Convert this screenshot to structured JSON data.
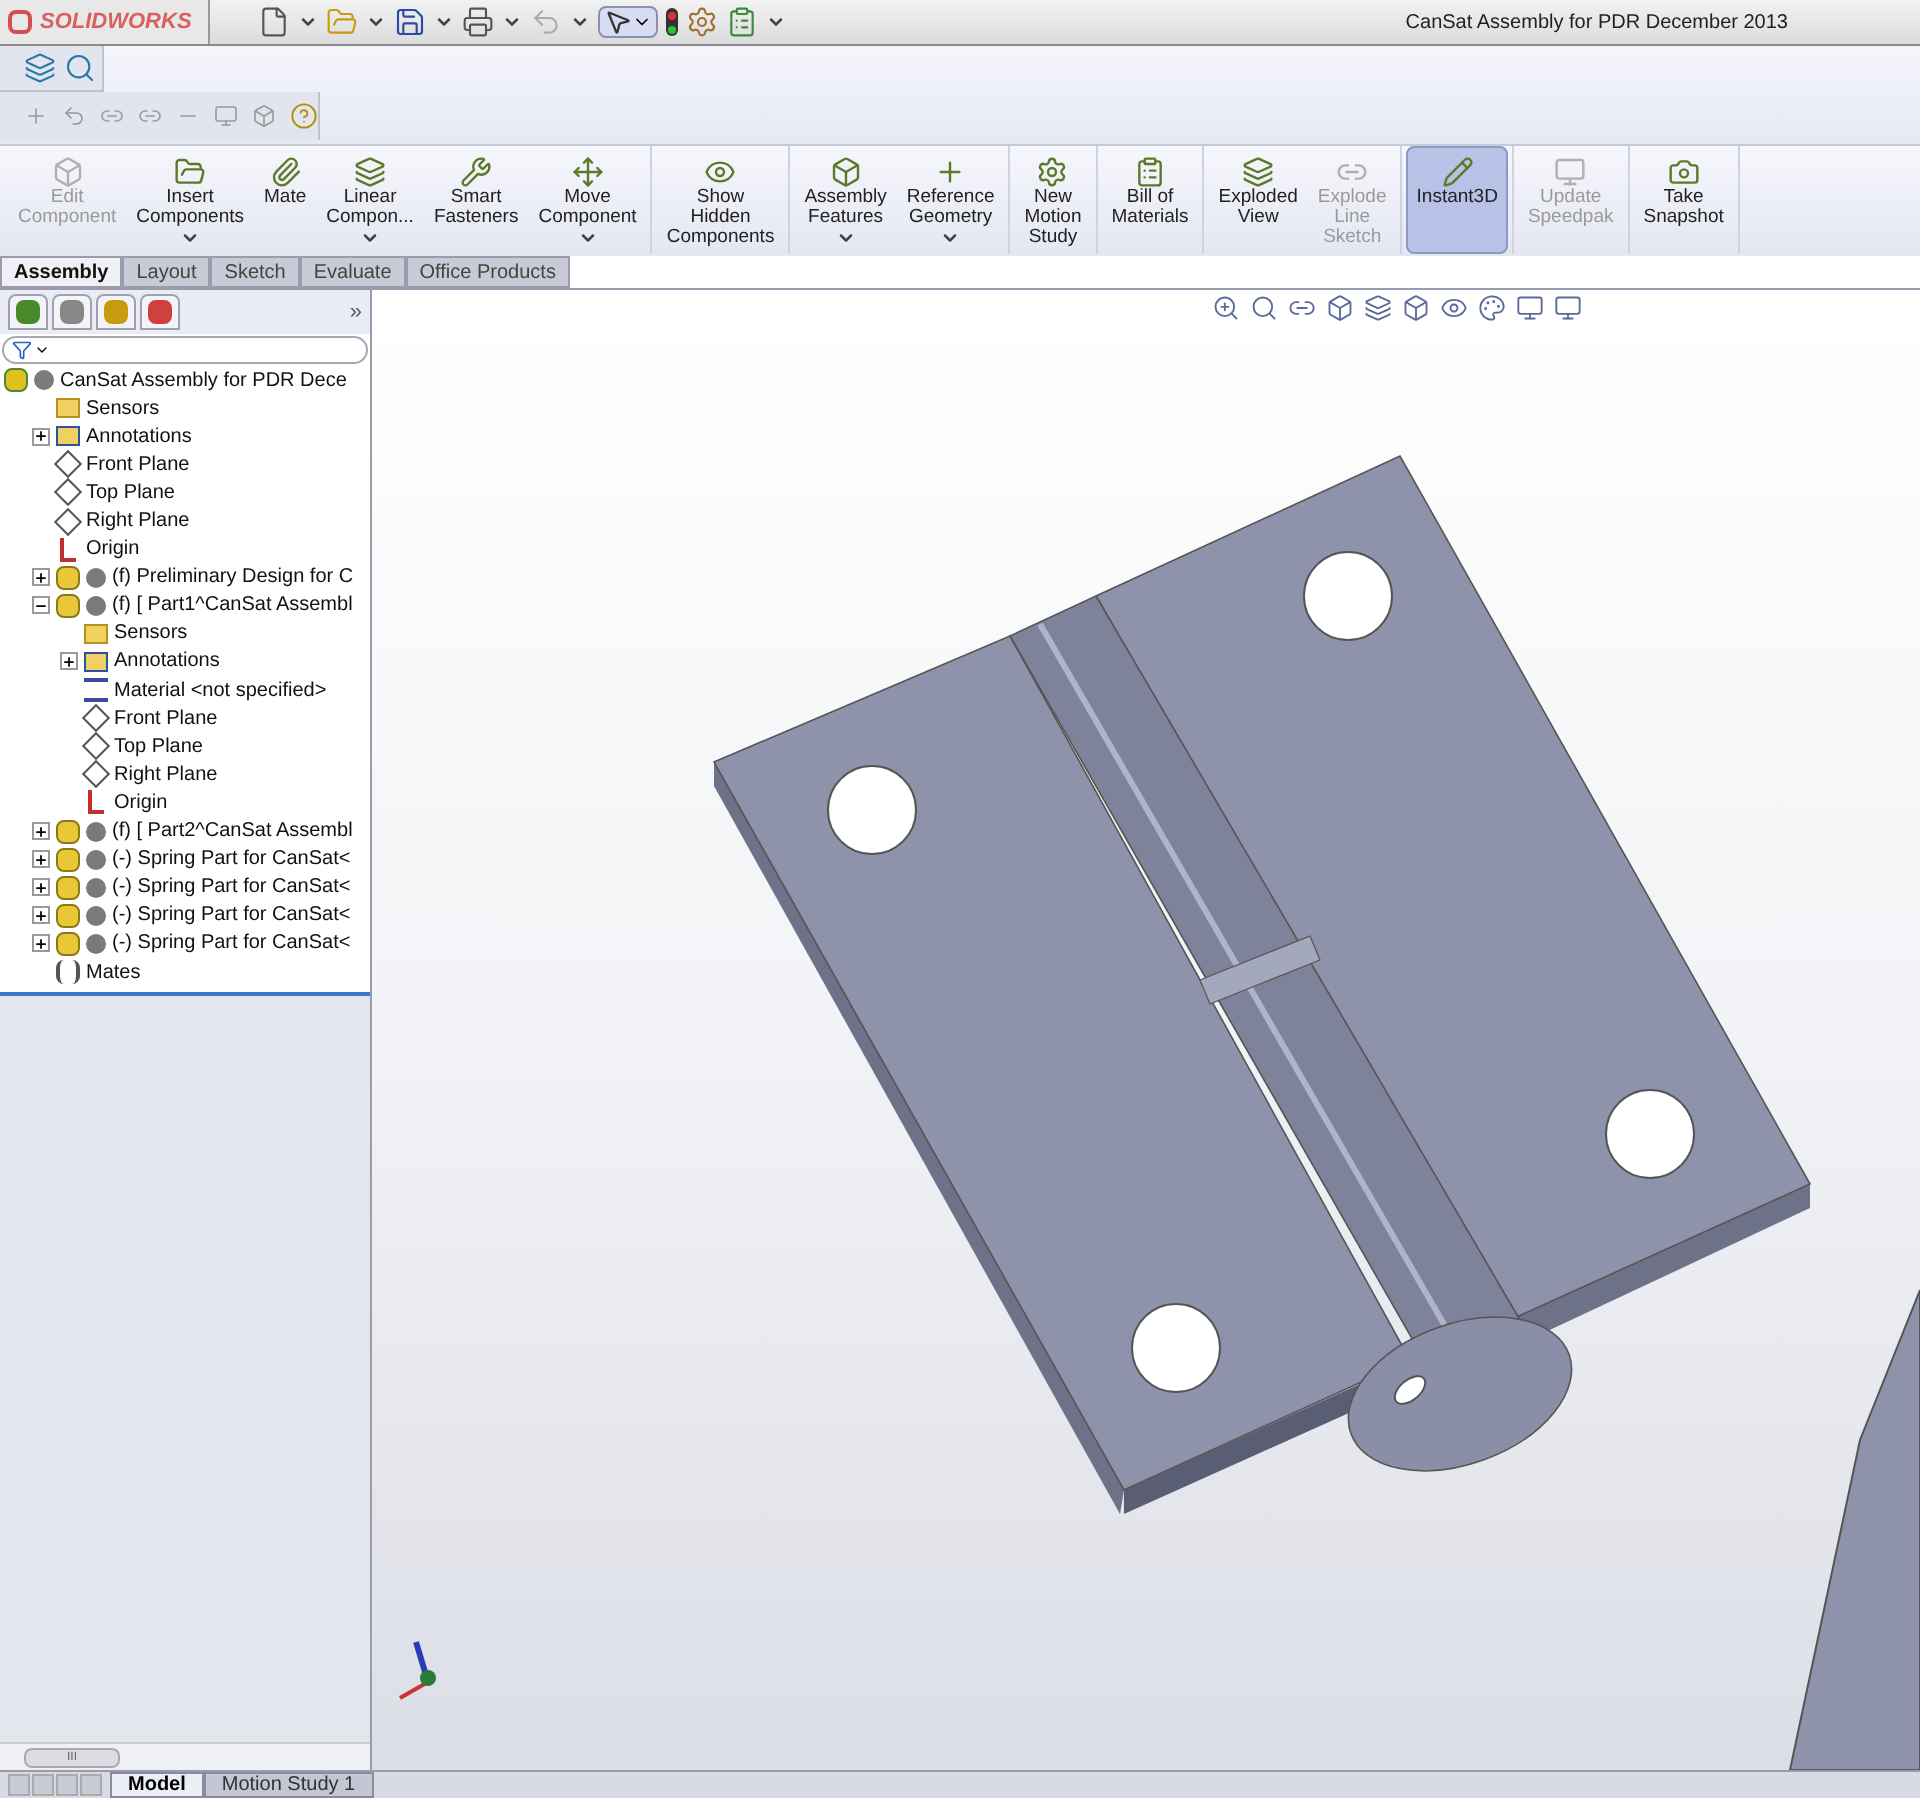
{
  "app": {
    "logo": "SOLIDWORKS",
    "title": "CanSat Assembly for PDR December 2013"
  },
  "ribbon": {
    "groups": [
      [
        {
          "label": "Edit\nComponent",
          "disabled": true,
          "selected": false,
          "dropdown": false
        },
        {
          "label": "Insert\nComponents",
          "disabled": false,
          "selected": false,
          "dropdown": true
        },
        {
          "label": "Mate",
          "disabled": false,
          "selected": false,
          "dropdown": false
        },
        {
          "label": "Linear\nCompon...",
          "disabled": false,
          "selected": false,
          "dropdown": true
        },
        {
          "label": "Smart\nFasteners",
          "disabled": false,
          "selected": false,
          "dropdown": false
        },
        {
          "label": "Move\nComponent",
          "disabled": false,
          "selected": false,
          "dropdown": true
        }
      ],
      [
        {
          "label": "Show\nHidden\nComponents",
          "disabled": false,
          "selected": false,
          "dropdown": false
        }
      ],
      [
        {
          "label": "Assembly\nFeatures",
          "disabled": false,
          "selected": false,
          "dropdown": true
        },
        {
          "label": "Reference\nGeometry",
          "disabled": false,
          "selected": false,
          "dropdown": true
        }
      ],
      [
        {
          "label": "New\nMotion\nStudy",
          "disabled": false,
          "selected": false,
          "dropdown": false
        }
      ],
      [
        {
          "label": "Bill of\nMaterials",
          "disabled": false,
          "selected": false,
          "dropdown": false
        }
      ],
      [
        {
          "label": "Exploded\nView",
          "disabled": false,
          "selected": false,
          "dropdown": false
        },
        {
          "label": "Explode\nLine\nSketch",
          "disabled": true,
          "selected": false,
          "dropdown": false
        }
      ],
      [
        {
          "label": "Instant3D",
          "disabled": false,
          "selected": true,
          "dropdown": false
        }
      ],
      [
        {
          "label": "Update\nSpeedpak",
          "disabled": true,
          "selected": false,
          "dropdown": false
        }
      ],
      [
        {
          "label": "Take\nSnapshot",
          "disabled": false,
          "selected": false,
          "dropdown": false
        }
      ]
    ]
  },
  "tabs": [
    {
      "label": "Assembly",
      "selected": true
    },
    {
      "label": "Layout",
      "selected": false
    },
    {
      "label": "Sketch",
      "selected": false
    },
    {
      "label": "Evaluate",
      "selected": false
    },
    {
      "label": "Office Products",
      "selected": false
    }
  ],
  "panel_expand": "»",
  "tree": [
    {
      "kind": "assembly",
      "label": "CanSat Assembly for PDR Dece",
      "children": [
        {
          "kind": "sensors",
          "label": "Sensors"
        },
        {
          "kind": "annotations",
          "label": "Annotations",
          "expanded": false
        },
        {
          "kind": "plane",
          "label": "Front Plane"
        },
        {
          "kind": "plane",
          "label": "Top Plane"
        },
        {
          "kind": "plane",
          "label": "Right Plane"
        },
        {
          "kind": "origin",
          "label": "Origin"
        },
        {
          "kind": "component",
          "label": "(f) Preliminary Design for C",
          "expanded": false
        },
        {
          "kind": "component",
          "label": "(f) [ Part1^CanSat Assembl",
          "expanded": true,
          "children": [
            {
              "kind": "sensors",
              "label": "Sensors"
            },
            {
              "kind": "annotations",
              "label": "Annotations",
              "expanded": false
            },
            {
              "kind": "material",
              "label": "Material <not specified>"
            },
            {
              "kind": "plane",
              "label": "Front Plane"
            },
            {
              "kind": "plane",
              "label": "Top Plane"
            },
            {
              "kind": "plane",
              "label": "Right Plane"
            },
            {
              "kind": "origin",
              "label": "Origin"
            }
          ]
        },
        {
          "kind": "component",
          "label": "(f) [ Part2^CanSat Assembl",
          "expanded": false
        },
        {
          "kind": "component",
          "label": "(-) Spring Part for CanSat<",
          "expanded": false
        },
        {
          "kind": "component",
          "label": "(-) Spring Part for CanSat<",
          "expanded": false
        },
        {
          "kind": "component",
          "label": "(-) Spring Part for CanSat<",
          "expanded": false
        },
        {
          "kind": "component",
          "label": "(-) Spring Part for CanSat<",
          "expanded": false
        },
        {
          "kind": "mates",
          "label": "Mates"
        }
      ]
    }
  ],
  "scrollbar_grip": "III",
  "bottom_tabs": [
    {
      "label": "Model",
      "selected": true
    },
    {
      "label": "Motion Study 1",
      "selected": false
    }
  ]
}
